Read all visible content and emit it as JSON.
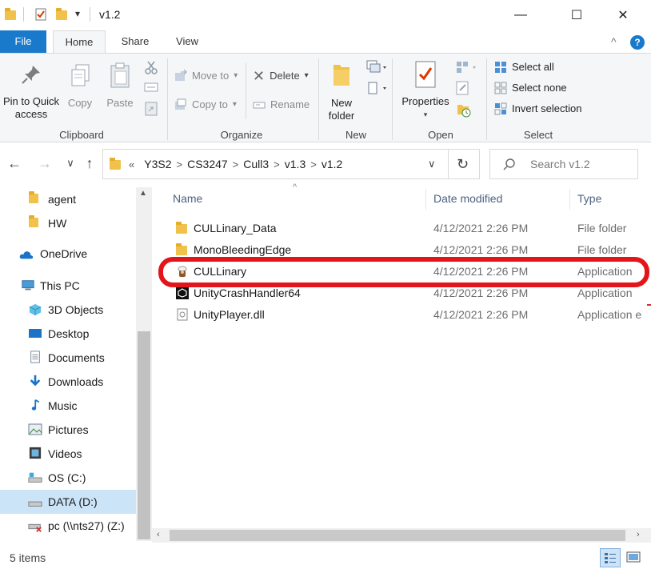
{
  "window": {
    "title": "v1.2",
    "minimize_glyph": "—",
    "maximize_glyph": "☐",
    "close_glyph": "✕",
    "qa_dropdown_glyph": "▾"
  },
  "ribbon_tabs": [
    {
      "label": "File"
    },
    {
      "label": "Home"
    },
    {
      "label": "Share"
    },
    {
      "label": "View"
    }
  ],
  "ribbon": {
    "collapse_glyph": "^",
    "help_glyph": "?",
    "clipboard": {
      "label": "Clipboard",
      "pin": "Pin to Quick access",
      "pin_line1": "Pin to Quick",
      "pin_line2": "access",
      "copy": "Copy",
      "paste": "Paste"
    },
    "organize": {
      "label": "Organize",
      "move_to": "Move to",
      "copy_to": "Copy to",
      "delete": "Delete",
      "rename": "Rename"
    },
    "new": {
      "label": "New",
      "new_folder_line1": "New",
      "new_folder_line2": "folder"
    },
    "open": {
      "label": "Open",
      "properties": "Properties"
    },
    "select": {
      "label": "Select",
      "select_all": "Select all",
      "select_none": "Select none",
      "invert": "Invert selection"
    }
  },
  "nav": {
    "back": "←",
    "forward": "→",
    "recent": "∨",
    "up": "↑"
  },
  "address": {
    "overflow": "«",
    "crumbs": [
      "Y3S2",
      "CS3247",
      "Cull3",
      "v1.3",
      "v1.2"
    ],
    "separator": ">",
    "dropdown": "∨",
    "refresh": "↻"
  },
  "search": {
    "placeholder": "Search v1.2"
  },
  "nav_pane": {
    "items": [
      {
        "label": "agent",
        "icon": "folder-icon"
      },
      {
        "label": "HW",
        "icon": "folder-icon"
      },
      {
        "label": "OneDrive",
        "icon": "cloud-icon"
      },
      {
        "label": "This PC",
        "icon": "computer-icon"
      },
      {
        "label": "3D Objects",
        "icon": "cube-icon"
      },
      {
        "label": "Desktop",
        "icon": "desktop-icon"
      },
      {
        "label": "Documents",
        "icon": "document-icon"
      },
      {
        "label": "Downloads",
        "icon": "download-icon"
      },
      {
        "label": "Music",
        "icon": "music-icon"
      },
      {
        "label": "Pictures",
        "icon": "picture-icon"
      },
      {
        "label": "Videos",
        "icon": "video-icon"
      },
      {
        "label": "OS (C:)",
        "icon": "drive-icon"
      },
      {
        "label": "DATA (D:)",
        "icon": "drive-icon"
      },
      {
        "label": "pc (\\\\nts27) (Z:)",
        "icon": "network-drive-icon"
      }
    ]
  },
  "columns": {
    "name": "Name",
    "date": "Date modified",
    "type": "Type"
  },
  "files": [
    {
      "name": "CULLinary_Data",
      "date": "4/12/2021 2:26 PM",
      "type": "File folder",
      "icon": "folder-icon"
    },
    {
      "name": "MonoBleedingEdge",
      "date": "4/12/2021 2:26 PM",
      "type": "File folder",
      "icon": "folder-icon"
    },
    {
      "name": "CULLinary",
      "date": "4/12/2021 2:26 PM",
      "type": "Application",
      "icon": "app-icon"
    },
    {
      "name": "UnityCrashHandler64",
      "date": "4/12/2021 2:26 PM",
      "type": "Application",
      "icon": "unity-icon"
    },
    {
      "name": "UnityPlayer.dll",
      "date": "4/12/2021 2:26 PM",
      "type": "Application e",
      "icon": "dll-icon"
    }
  ],
  "status": {
    "item_count": "5 items"
  },
  "colors": {
    "accent": "#1979ca",
    "highlight_ring": "#e3151b",
    "selected_nav": "#cce4f7"
  }
}
